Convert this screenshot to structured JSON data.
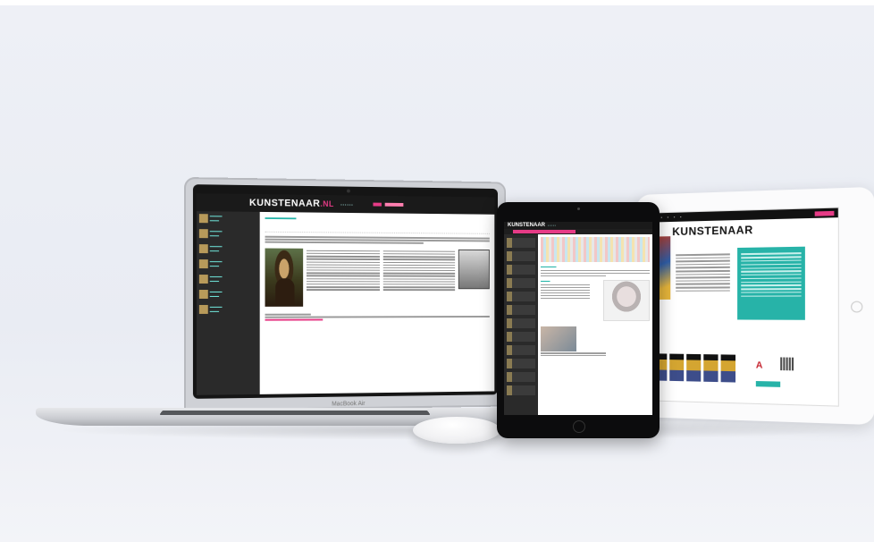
{
  "laptop": {
    "site_logo": "KUNSTENAAR",
    "site_logo_suffix": ".NL",
    "model_label": "MacBook Air"
  },
  "tablet_black": {
    "site_logo": "KUNSTENAAR"
  },
  "tablet_white": {
    "site_logo": "KUNSTENAAR"
  },
  "colors": {
    "brand_pink": "#e63b86",
    "brand_teal": "#27b3a8",
    "background": "#eceef4"
  }
}
